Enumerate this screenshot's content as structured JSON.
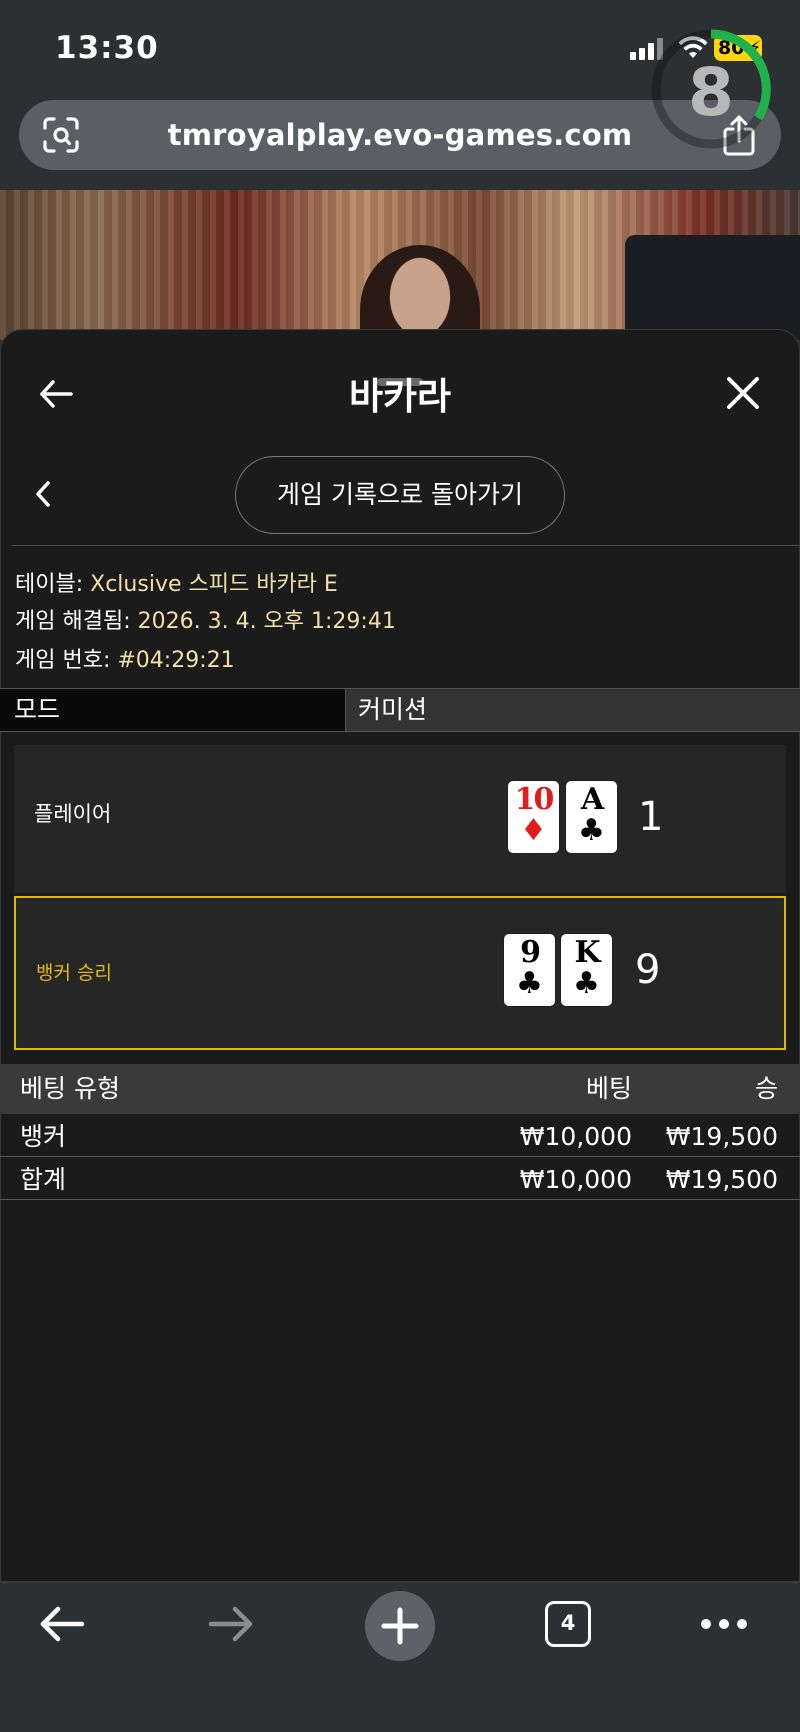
{
  "status_bar": {
    "time": "13:30",
    "battery": "80"
  },
  "address_bar": {
    "url": "tmroyalplay.evo-games.com"
  },
  "video": {
    "countdown": "8"
  },
  "header": {
    "title": "바카라"
  },
  "nav": {
    "return_label": "게임 기록으로 돌아가기"
  },
  "info": {
    "table_label": "테이블: ",
    "table_value": "Xclusive 스피드 바카라 E",
    "resolved_label": "게임 해결됨: ",
    "resolved_value": "2026. 3. 4. 오후 1:29:41",
    "number_label": "게임 번호: ",
    "number_value": "#04:29:21"
  },
  "tabs": {
    "mode": "모드",
    "commission": "커미션"
  },
  "hands": {
    "player": {
      "label": "플레이어",
      "score": "1",
      "cards": [
        {
          "rank": "10",
          "suit": "♦",
          "color": "red"
        },
        {
          "rank": "A",
          "suit": "♣",
          "color": "black"
        }
      ]
    },
    "banker": {
      "label": "뱅커 승리",
      "score": "9",
      "cards": [
        {
          "rank": "9",
          "suit": "♣",
          "color": "black"
        },
        {
          "rank": "K",
          "suit": "♣",
          "color": "black"
        }
      ]
    }
  },
  "bets": {
    "headers": {
      "type": "베팅 유형",
      "bet": "베팅",
      "win": "승"
    },
    "rows": [
      {
        "type": "뱅커",
        "bet": "₩10,000",
        "win": "₩19,500"
      }
    ],
    "total": {
      "type": "합계",
      "bet": "₩10,000",
      "win": "₩19,500"
    }
  },
  "toolbar": {
    "tab_count": "4"
  },
  "colors": {
    "accent_gold": "#e0b80f",
    "info_value": "#f0e0a8",
    "countdown_ring": "#1fb24a",
    "battery": "#ffd60a"
  }
}
